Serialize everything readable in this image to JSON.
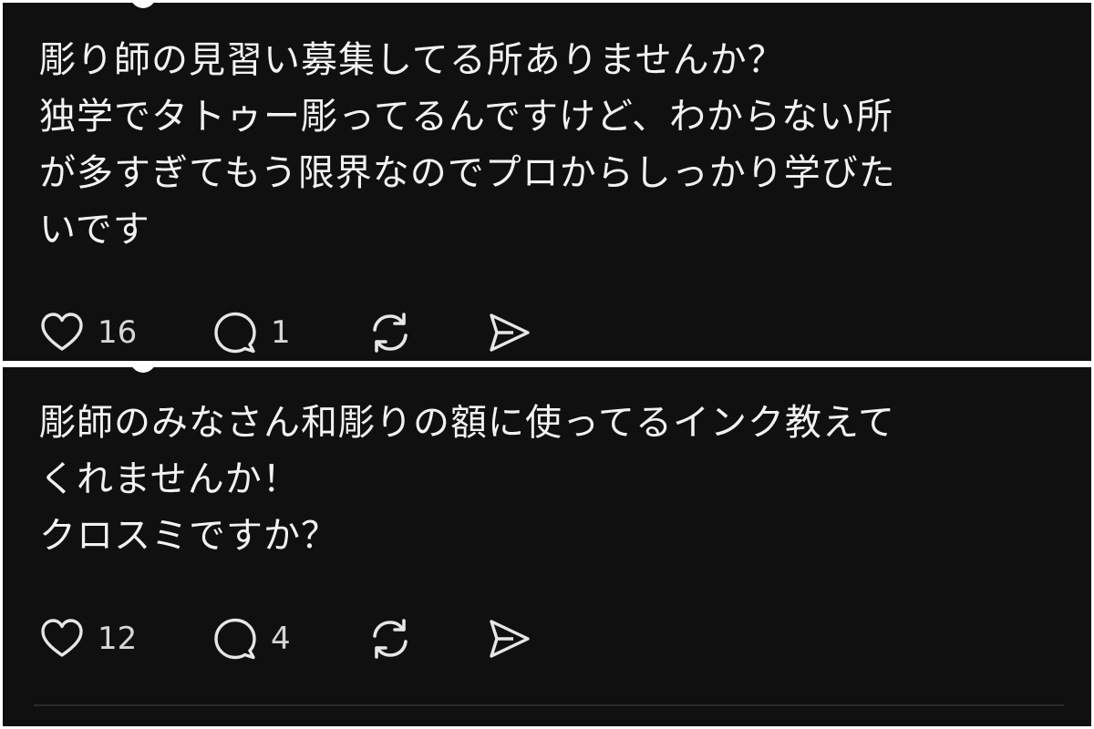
{
  "posts": [
    {
      "text": "彫り師の見習い募集してる所ありませんか？\n独学でタトゥー彫ってるんですけど、わからない所\nが多すぎてもう限界なのでプロからしっかり学びた\nいです",
      "likes": "16",
      "replies": "1"
    },
    {
      "text": "彫師のみなさん和彫りの額に使ってるインク教えて\nくれませんか！\nクロスミですか？",
      "likes": "12",
      "replies": "4"
    }
  ],
  "icons": {
    "like": "heart-icon",
    "reply": "comment-icon",
    "repost": "repost-icon",
    "share": "send-icon"
  },
  "colors": {
    "background": "#101010",
    "text": "#f2f2f2",
    "icon": "#e6e6e6",
    "divider": "#2a2a2a"
  }
}
